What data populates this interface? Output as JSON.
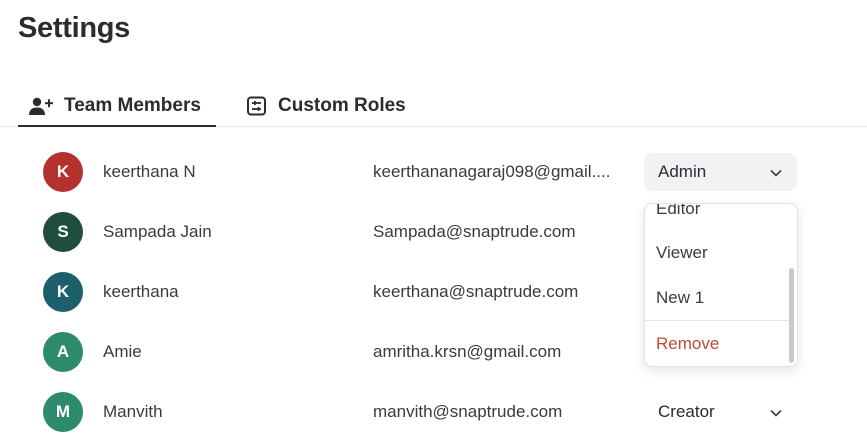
{
  "page": {
    "title": "Settings"
  },
  "tabs": [
    {
      "label": "Team Members",
      "icon": "user-plus-icon",
      "active": true
    },
    {
      "label": "Custom Roles",
      "icon": "sliders-icon",
      "active": false
    }
  ],
  "members": [
    {
      "initial": "K",
      "name": "keerthana N",
      "email": "keerthananagaraj098@gmail....",
      "role": "Admin",
      "avatar_color": "#b3322d"
    },
    {
      "initial": "S",
      "name": "Sampada Jain",
      "email": "Sampada@snaptrude.com",
      "role": "",
      "avatar_color": "#1f4d3f"
    },
    {
      "initial": "K",
      "name": "keerthana",
      "email": "keerthana@snaptrude.com",
      "role": "",
      "avatar_color": "#1d5f6b"
    },
    {
      "initial": "A",
      "name": "Amie",
      "email": "amritha.krsn@gmail.com",
      "role": "",
      "avatar_color": "#2e8a6c"
    },
    {
      "initial": "M",
      "name": "Manvith",
      "email": "manvith@snaptrude.com",
      "role": "Creator",
      "avatar_color": "#2e8a6c"
    }
  ],
  "role_dropdown": {
    "items": [
      "Editor",
      "Viewer",
      "New 1"
    ],
    "remove_label": "Remove",
    "remove_color": "#c24a36"
  }
}
